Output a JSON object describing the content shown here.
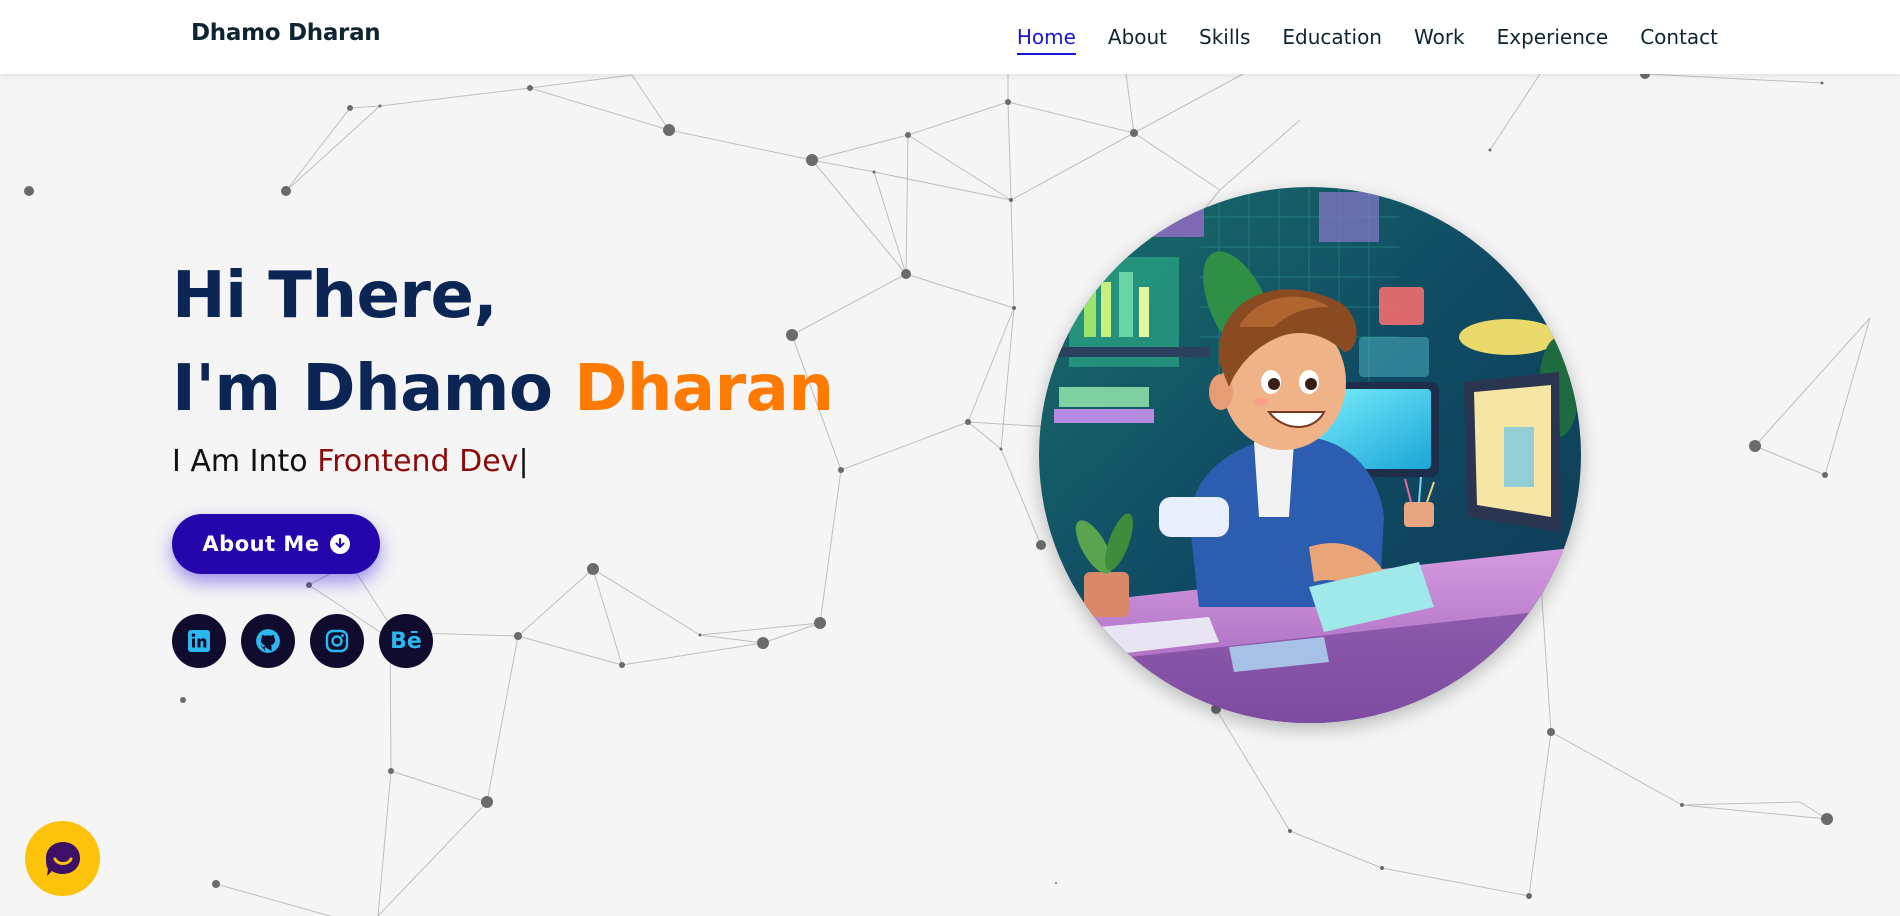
{
  "brand": "Dhamo Dharan",
  "nav": {
    "items": [
      "Home",
      "About",
      "Skills",
      "Education",
      "Work",
      "Experience",
      "Contact"
    ],
    "active": "Home"
  },
  "hero": {
    "greeting": "Hi There,",
    "intro_prefix": "I'm Dhamo ",
    "intro_accent": "Dharan",
    "typing_prefix": "I Am Into ",
    "typing_role": "Frontend Dev",
    "typing_caret": "|"
  },
  "about_button": {
    "label": "About Me",
    "icon": "arrow-down-circle-icon"
  },
  "socials": [
    {
      "name": "linkedin-icon"
    },
    {
      "name": "github-icon"
    },
    {
      "name": "instagram-icon"
    },
    {
      "name": "behance-icon",
      "glyph": "Bē"
    }
  ],
  "avatar": {
    "icon": "developer-illustration"
  },
  "chat": {
    "icon": "chat-bubble-icon"
  },
  "colors": {
    "navy": "#0b2554",
    "orange": "#ff7a00",
    "role_red": "#8b0a0a",
    "button": "#2506ad",
    "nav_active": "#1a16d8",
    "social_bg": "#100c2e",
    "social_icon": "#2bb8f0",
    "chat": "#fdc20a"
  }
}
